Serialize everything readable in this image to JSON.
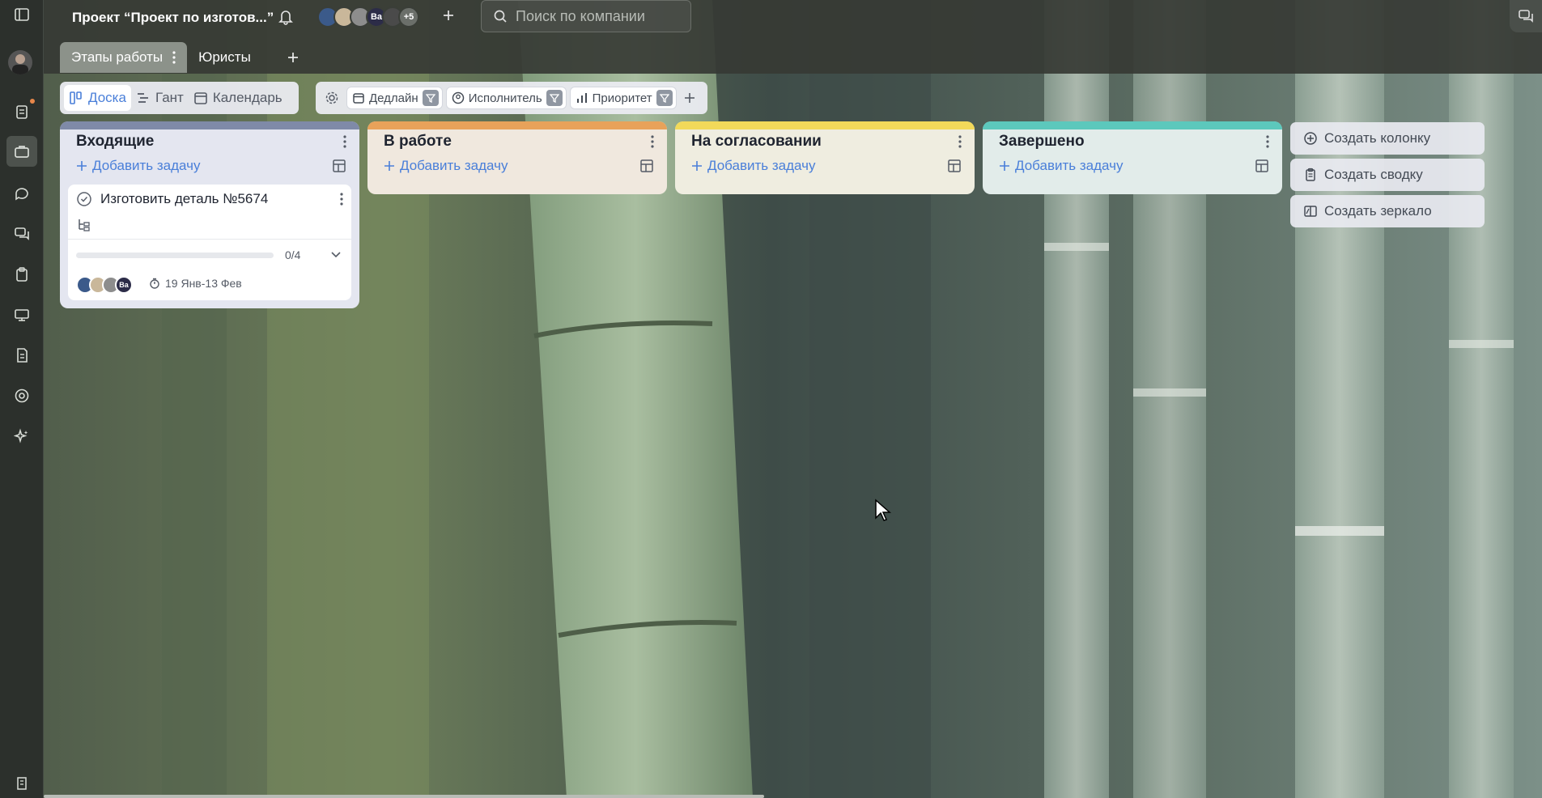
{
  "project": {
    "title": "Проект “Проект по изготов...”"
  },
  "members": {
    "avatars": [
      {
        "initials": "",
        "color": "#3b5a8a"
      },
      {
        "initials": "",
        "color": "#c9b79a"
      },
      {
        "initials": "",
        "color": "#8d8d8d"
      },
      {
        "initials": "Ва",
        "color": "#2c2c48"
      },
      {
        "initials": "",
        "color": "#4a4a4a"
      }
    ],
    "more": "+5"
  },
  "search": {
    "placeholder": "Поиск по компании",
    "value": ""
  },
  "tabs": [
    {
      "label": "Этапы работы",
      "active": true
    },
    {
      "label": "Юристы",
      "active": false
    }
  ],
  "views": [
    {
      "label": "Доска",
      "icon": "board-icon",
      "active": true
    },
    {
      "label": "Гант",
      "icon": "gantt-icon",
      "active": false
    },
    {
      "label": "Календарь",
      "icon": "calendar-icon",
      "active": false
    }
  ],
  "filters": [
    {
      "label": "Дедлайн",
      "icon": "calendar-icon"
    },
    {
      "label": "Исполнитель",
      "icon": "user-icon"
    },
    {
      "label": "Приоритет",
      "icon": "bars-icon"
    }
  ],
  "columns": [
    {
      "title": "Входящие",
      "color": "#7f8aa8",
      "bg": "#e4e6f0",
      "add_label": "Добавить задачу"
    },
    {
      "title": "В работе",
      "color": "#e8a25a",
      "bg": "#f0e8de",
      "add_label": "Добавить задачу"
    },
    {
      "title": "На согласовании",
      "color": "#f2d95a",
      "bg": "#efede0",
      "add_label": "Добавить задачу"
    },
    {
      "title": "Завершено",
      "color": "#5cc8bc",
      "bg": "#e2ecea",
      "add_label": "Добавить задачу"
    }
  ],
  "card": {
    "title": "Изготовить деталь №5674",
    "progress_text": "0/4",
    "progress": 0,
    "avatars": [
      {
        "initials": "",
        "color": "#3b5a8a"
      },
      {
        "initials": "",
        "color": "#c9b79a"
      },
      {
        "initials": "",
        "color": "#8d8d8d"
      },
      {
        "initials": "Ва",
        "color": "#2c2c48"
      }
    ],
    "dates": "19 Янв-13 Фев"
  },
  "actions": [
    {
      "label": "Создать колонку",
      "icon": "plus-circle-icon"
    },
    {
      "label": "Создать сводку",
      "icon": "clipboard-icon"
    },
    {
      "label": "Создать зеркало",
      "icon": "mirror-icon"
    }
  ]
}
